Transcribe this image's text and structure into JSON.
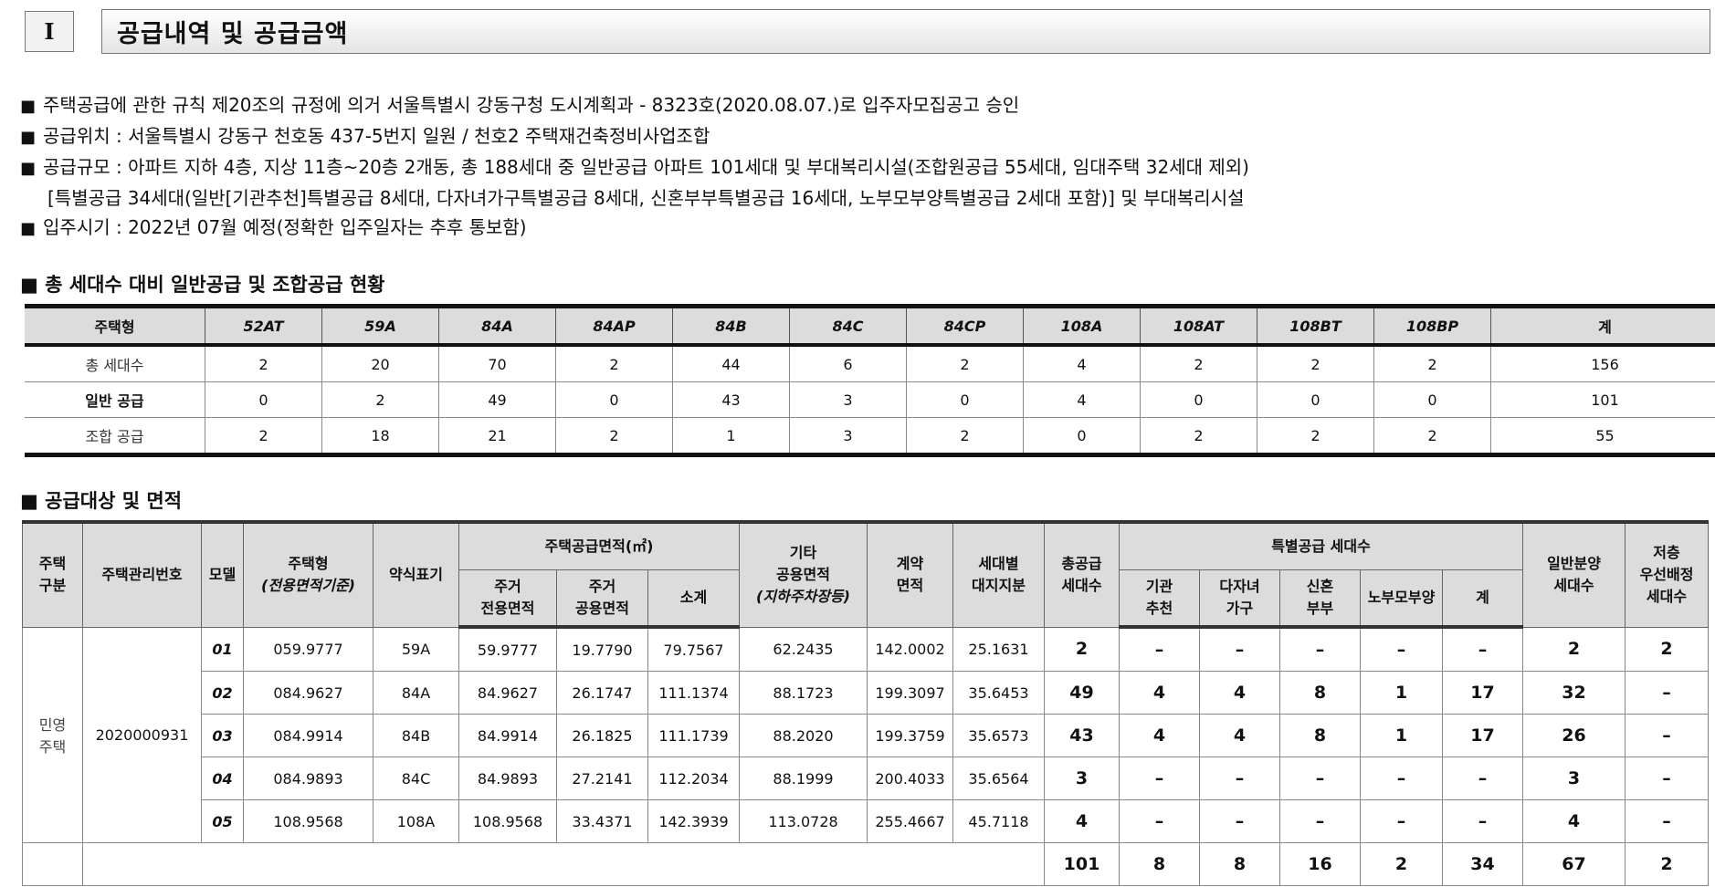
{
  "section": {
    "number": "I",
    "title": "공급내역 및 공급금액"
  },
  "bullets": [
    "주택공급에 관한 규칙 제20조의 규정에 의거 서울특별시 강동구청 도시계획과 - 8323호(2020.08.07.)로 입주자모집공고 승인",
    "공급위치 : 서울특별시 강동구 천호동 437-5번지 일원 / 천호2 주택재건축정비사업조합",
    "공급규모 : 아파트 지하 4층, 지상 11층~20층 2개동, 총 188세대 중 일반공급 아파트 101세대 및 부대복리시설(조합원공급 55세대, 임대주택 32세대 제외)",
    "[특별공급 34세대(일반[기관추천]특별공급 8세대, 다자녀가구특별공급 8세대, 신혼부부특별공급 16세대, 노부모부양특별공급 2세대 포함)] 및 부대복리시설",
    "입주시기 : 2022년 07월 예정(정확한 입주일자는 추후 통보함)"
  ],
  "bullet_mark": "■",
  "table1": {
    "heading": "총 세대수 대비 일반공급 및 조합공급 현황",
    "columns": [
      "주택형",
      "52AT",
      "59A",
      "84A",
      "84AP",
      "84B",
      "84C",
      "84CP",
      "108A",
      "108AT",
      "108BT",
      "108BP",
      "계"
    ],
    "rows": [
      {
        "label": "총 세대수",
        "values": [
          "2",
          "20",
          "70",
          "2",
          "44",
          "6",
          "2",
          "4",
          "2",
          "2",
          "2",
          "156"
        ]
      },
      {
        "label": "일반 공급",
        "values": [
          "0",
          "2",
          "49",
          "0",
          "43",
          "3",
          "0",
          "4",
          "0",
          "0",
          "0",
          "101"
        ]
      },
      {
        "label": "조합 공급",
        "values": [
          "2",
          "18",
          "21",
          "2",
          "1",
          "3",
          "2",
          "0",
          "2",
          "2",
          "2",
          "55"
        ]
      }
    ]
  },
  "table2": {
    "heading": "공급대상 및 면적",
    "headers": {
      "housing_type": "주택\n구분",
      "mgmt_no": "주택관리번호",
      "model": "모델",
      "house_type": "주택형",
      "house_type_sub": "(전용면적기준)",
      "abbr": "약식표기",
      "supply_area": "주택공급면적(㎡)",
      "exclusive": "주거\n전용면적",
      "common": "주거\n공용면적",
      "subtotal": "소계",
      "other_common": "기타\n공용면적",
      "other_common_sub": "(지하주차장등)",
      "contract_area": "계약\n면적",
      "land_share": "세대별\n대지지분",
      "total_supply": "총공급\n세대수",
      "special": "특별공급 세대수",
      "agency": "기관\n추천",
      "multi_child": "다자녀\n가구",
      "newlywed": "신혼\n부부",
      "elderly": "노부모부양",
      "special_total": "계",
      "general_sale": "일반분양\n세대수",
      "low_floor": "저층\n우선배정\n세대수"
    },
    "housing_type_value": "민영\n주택",
    "mgmt_no_value": "2020000931",
    "rows": [
      {
        "model": "01",
        "type": "059.9777",
        "abbr": "59A",
        "exclusive": "59.9777",
        "common": "19.7790",
        "subtotal": "79.7567",
        "other": "62.2435",
        "contract": "142.0002",
        "land": "25.1631",
        "total": "2",
        "agency": "–",
        "multi": "–",
        "newly": "–",
        "elderly": "–",
        "sp_total": "–",
        "general": "2",
        "low": "2"
      },
      {
        "model": "02",
        "type": "084.9627",
        "abbr": "84A",
        "exclusive": "84.9627",
        "common": "26.1747",
        "subtotal": "111.1374",
        "other": "88.1723",
        "contract": "199.3097",
        "land": "35.6453",
        "total": "49",
        "agency": "4",
        "multi": "4",
        "newly": "8",
        "elderly": "1",
        "sp_total": "17",
        "general": "32",
        "low": "–"
      },
      {
        "model": "03",
        "type": "084.9914",
        "abbr": "84B",
        "exclusive": "84.9914",
        "common": "26.1825",
        "subtotal": "111.1739",
        "other": "88.2020",
        "contract": "199.3759",
        "land": "35.6573",
        "total": "43",
        "agency": "4",
        "multi": "4",
        "newly": "8",
        "elderly": "1",
        "sp_total": "17",
        "general": "26",
        "low": "–"
      },
      {
        "model": "04",
        "type": "084.9893",
        "abbr": "84C",
        "exclusive": "84.9893",
        "common": "27.2141",
        "subtotal": "112.2034",
        "other": "88.1999",
        "contract": "200.4033",
        "land": "35.6564",
        "total": "3",
        "agency": "–",
        "multi": "–",
        "newly": "–",
        "elderly": "–",
        "sp_total": "–",
        "general": "3",
        "low": "–"
      },
      {
        "model": "05",
        "type": "108.9568",
        "abbr": "108A",
        "exclusive": "108.9568",
        "common": "33.4371",
        "subtotal": "142.3939",
        "other": "113.0728",
        "contract": "255.4667",
        "land": "45.7118",
        "total": "4",
        "agency": "–",
        "multi": "–",
        "newly": "–",
        "elderly": "–",
        "sp_total": "–",
        "general": "4",
        "low": "–"
      }
    ],
    "total_row": {
      "total": "101",
      "agency": "8",
      "multi": "8",
      "newly": "16",
      "elderly": "2",
      "sp_total": "34",
      "general": "67",
      "low": "2"
    }
  }
}
